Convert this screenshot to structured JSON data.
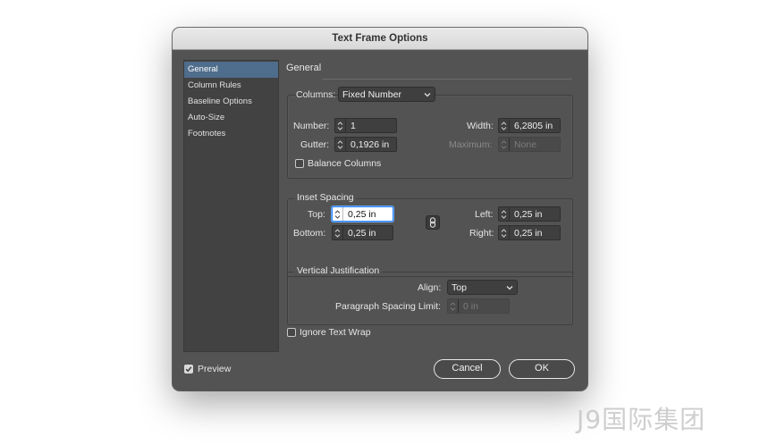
{
  "window": {
    "title": "Text Frame Options"
  },
  "sidebar": {
    "items": [
      {
        "label": "General",
        "selected": true
      },
      {
        "label": "Column Rules",
        "selected": false
      },
      {
        "label": "Baseline Options",
        "selected": false
      },
      {
        "label": "Auto-Size",
        "selected": false
      },
      {
        "label": "Footnotes",
        "selected": false
      }
    ]
  },
  "main": {
    "section_title": "General",
    "columns": {
      "label": "Columns:",
      "select_value": "Fixed Number",
      "number_label": "Number:",
      "number_value": "1",
      "gutter_label": "Gutter:",
      "gutter_value": "0,1926 in",
      "width_label": "Width:",
      "width_value": "6,2805 in",
      "maximum_label": "Maximum:",
      "maximum_value": "None",
      "balance_label": "Balance Columns",
      "balance_checked": false
    },
    "inset_spacing": {
      "title": "Inset Spacing",
      "top_label": "Top:",
      "top_value": "0,25 in",
      "bottom_label": "Bottom:",
      "bottom_value": "0,25 in",
      "left_label": "Left:",
      "left_value": "0,25 in",
      "right_label": "Right:",
      "right_value": "0,25 in"
    },
    "vertical_justification": {
      "title": "Vertical Justification",
      "align_label": "Align:",
      "align_value": "Top",
      "spacing_limit_label": "Paragraph Spacing Limit:",
      "spacing_limit_value": "0 in"
    },
    "ignore_wrap_label": "Ignore Text Wrap",
    "ignore_wrap_checked": false
  },
  "footer": {
    "preview_label": "Preview",
    "preview_checked": true,
    "cancel_label": "Cancel",
    "ok_label": "OK"
  },
  "watermark": "J9国际集团",
  "colors": {
    "dialog_bg": "#535353",
    "selection": "#4f6d8c",
    "focus": "#2c86ff"
  }
}
